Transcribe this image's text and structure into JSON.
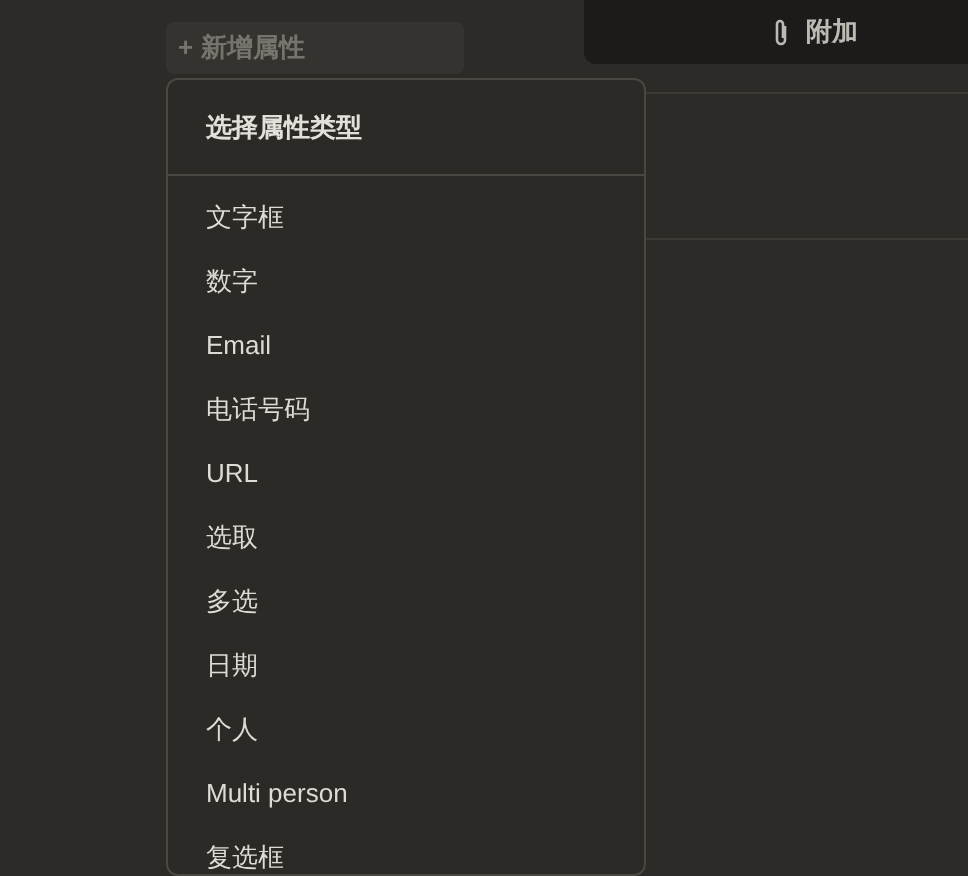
{
  "add_property_button": {
    "icon": "+",
    "label": "新增属性"
  },
  "attach_button": {
    "label": "附加"
  },
  "property_type_menu": {
    "title": "选择属性类型",
    "items": [
      {
        "label": "文字框"
      },
      {
        "label": "数字"
      },
      {
        "label": "Email"
      },
      {
        "label": "电话号码"
      },
      {
        "label": "URL"
      },
      {
        "label": "选取"
      },
      {
        "label": "多选"
      },
      {
        "label": "日期"
      },
      {
        "label": "个人"
      },
      {
        "label": "Multi person"
      },
      {
        "label": "复选框"
      }
    ]
  }
}
